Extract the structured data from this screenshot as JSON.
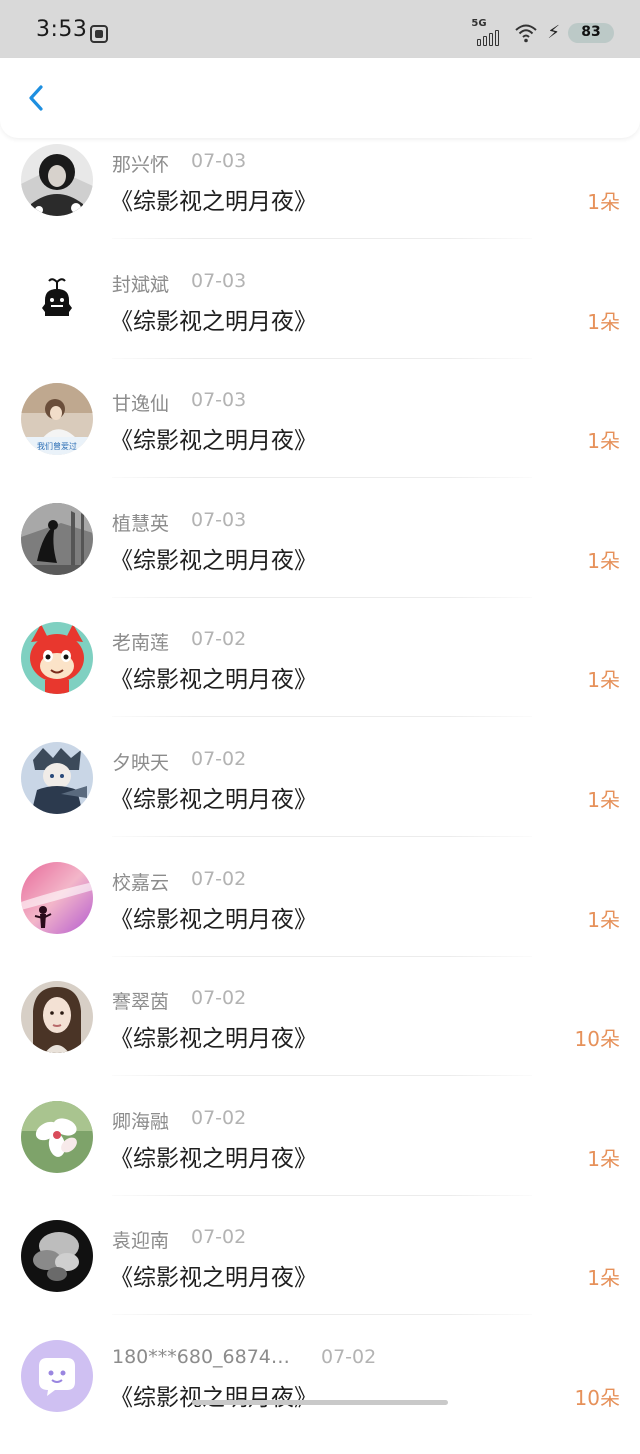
{
  "status_bar": {
    "time": "3:53",
    "network": "5G",
    "battery": "83"
  },
  "list": {
    "items": [
      {
        "name": "那兴怀",
        "date": "07-03",
        "book": "《综影视之明月夜》",
        "count": "1朵"
      },
      {
        "name": "封斌斌",
        "date": "07-03",
        "book": "《综影视之明月夜》",
        "count": "1朵"
      },
      {
        "name": "甘逸仙",
        "date": "07-03",
        "book": "《综影视之明月夜》",
        "count": "1朵"
      },
      {
        "name": "植慧英",
        "date": "07-03",
        "book": "《综影视之明月夜》",
        "count": "1朵"
      },
      {
        "name": "老南莲",
        "date": "07-02",
        "book": "《综影视之明月夜》",
        "count": "1朵"
      },
      {
        "name": "夕映天",
        "date": "07-02",
        "book": "《综影视之明月夜》",
        "count": "1朵"
      },
      {
        "name": "校嘉云",
        "date": "07-02",
        "book": "《综影视之明月夜》",
        "count": "1朵"
      },
      {
        "name": "謇翠茵",
        "date": "07-02",
        "book": "《综影视之明月夜》",
        "count": "10朵"
      },
      {
        "name": "卿海融",
        "date": "07-02",
        "book": "《综影视之明月夜》",
        "count": "1朵"
      },
      {
        "name": "袁迎南",
        "date": "07-02",
        "book": "《综影视之明月夜》",
        "count": "1朵"
      },
      {
        "name": "180***680_6874…",
        "date": "07-02",
        "book": "《综影视之明月夜》",
        "count": "10朵"
      }
    ]
  }
}
